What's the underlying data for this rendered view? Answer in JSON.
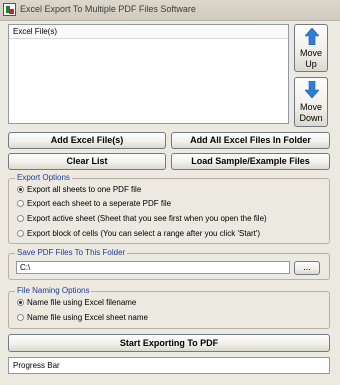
{
  "window": {
    "title": "Excel Export To Multiple PDF Files Software"
  },
  "file_list": {
    "header": "Excel File(s)"
  },
  "move_buttons": {
    "up_line1": "Move",
    "up_line2": "Up",
    "down_line1": "Move",
    "down_line2": "Down"
  },
  "buttons": {
    "add_files": "Add Excel File(s)",
    "add_folder": "Add All Excel Files In Folder",
    "clear_list": "Clear List",
    "load_sample": "Load Sample/Example Files",
    "browse": "...",
    "start": "Start Exporting To PDF"
  },
  "export_options": {
    "label": "Export Options",
    "selected_index": 0,
    "items": [
      "Export all sheets to one PDF file",
      "Export each sheet to a seperate PDF file",
      "Export active sheet (Sheet that you see first when you open the file)",
      "Export block of cells (You can select a range after you click 'Start')"
    ]
  },
  "save_folder": {
    "label": "Save PDF Files To This Folder",
    "value": "C:\\"
  },
  "file_naming": {
    "label": "File Naming Options",
    "selected_index": 0,
    "items": [
      "Name file using Excel filename",
      "Name file using Excel sheet name"
    ]
  },
  "status": {
    "progress_text": "Progress Bar"
  },
  "colors": {
    "window_bg": "#ece9e0",
    "group_label": "#1f3d99",
    "arrow_blue": "#2f7fd6"
  },
  "icons": {
    "app": "app-excel-pdf-icon",
    "move_up": "arrow-up-icon",
    "move_down": "arrow-down-icon"
  }
}
